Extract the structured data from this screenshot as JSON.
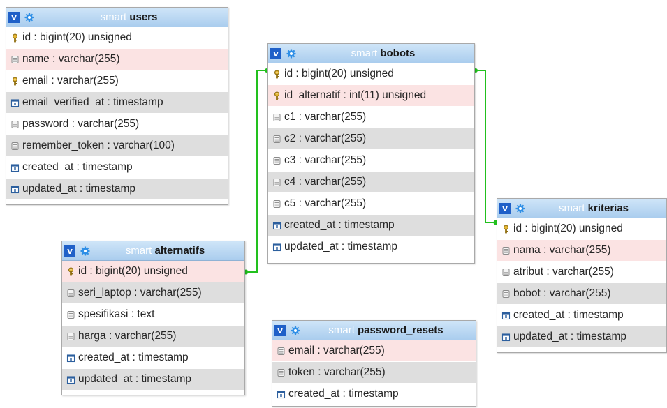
{
  "tables": {
    "users": {
      "db": "smart",
      "name": "users",
      "columns": [
        {
          "text": "id : bigint(20) unsigned",
          "icon": "key-icon"
        },
        {
          "text": "name : varchar(255)",
          "icon": "column-icon"
        },
        {
          "text": "email : varchar(255)",
          "icon": "key-icon"
        },
        {
          "text": "email_verified_at : timestamp",
          "icon": "timestamp-icon"
        },
        {
          "text": "password : varchar(255)",
          "icon": "column-icon"
        },
        {
          "text": "remember_token : varchar(100)",
          "icon": "column-icon"
        },
        {
          "text": "created_at : timestamp",
          "icon": "timestamp-icon"
        },
        {
          "text": "updated_at : timestamp",
          "icon": "timestamp-icon"
        }
      ]
    },
    "bobots": {
      "db": "smart",
      "name": "bobots",
      "columns": [
        {
          "text": "id : bigint(20) unsigned",
          "icon": "key-icon"
        },
        {
          "text": "id_alternatif : int(11) unsigned",
          "icon": "key-icon"
        },
        {
          "text": "c1 : varchar(255)",
          "icon": "column-icon"
        },
        {
          "text": "c2 : varchar(255)",
          "icon": "column-icon"
        },
        {
          "text": "c3 : varchar(255)",
          "icon": "column-icon"
        },
        {
          "text": "c4 : varchar(255)",
          "icon": "column-icon"
        },
        {
          "text": "c5 : varchar(255)",
          "icon": "column-icon"
        },
        {
          "text": "created_at : timestamp",
          "icon": "timestamp-icon"
        },
        {
          "text": "updated_at : timestamp",
          "icon": "timestamp-icon"
        }
      ]
    },
    "kriterias": {
      "db": "smart",
      "name": "kriterias",
      "columns": [
        {
          "text": "id : bigint(20) unsigned",
          "icon": "key-icon"
        },
        {
          "text": "nama : varchar(255)",
          "icon": "column-icon"
        },
        {
          "text": "atribut : varchar(255)",
          "icon": "column-icon"
        },
        {
          "text": "bobot : varchar(255)",
          "icon": "column-icon"
        },
        {
          "text": "created_at : timestamp",
          "icon": "timestamp-icon"
        },
        {
          "text": "updated_at : timestamp",
          "icon": "timestamp-icon"
        }
      ]
    },
    "alternatifs": {
      "db": "smart",
      "name": "alternatifs",
      "columns": [
        {
          "text": "id : bigint(20) unsigned",
          "icon": "key-icon"
        },
        {
          "text": "seri_laptop : varchar(255)",
          "icon": "column-icon"
        },
        {
          "text": "spesifikasi : text",
          "icon": "column-icon"
        },
        {
          "text": "harga : varchar(255)",
          "icon": "column-icon"
        },
        {
          "text": "created_at : timestamp",
          "icon": "timestamp-icon"
        },
        {
          "text": "updated_at : timestamp",
          "icon": "timestamp-icon"
        }
      ]
    },
    "password_resets": {
      "db": "smart",
      "name": "password_resets",
      "columns": [
        {
          "text": "email : varchar(255)",
          "icon": "column-icon"
        },
        {
          "text": "token : varchar(255)",
          "icon": "column-icon"
        },
        {
          "text": "created_at : timestamp",
          "icon": "timestamp-icon"
        }
      ]
    }
  },
  "header_button_label": "v",
  "colors": {
    "header_top": "#cfe5f8",
    "header_bottom": "#aacdee",
    "highlight_row": "#fbe3e3",
    "alt_row": "#dedede",
    "relation_line": "#22c01e"
  }
}
